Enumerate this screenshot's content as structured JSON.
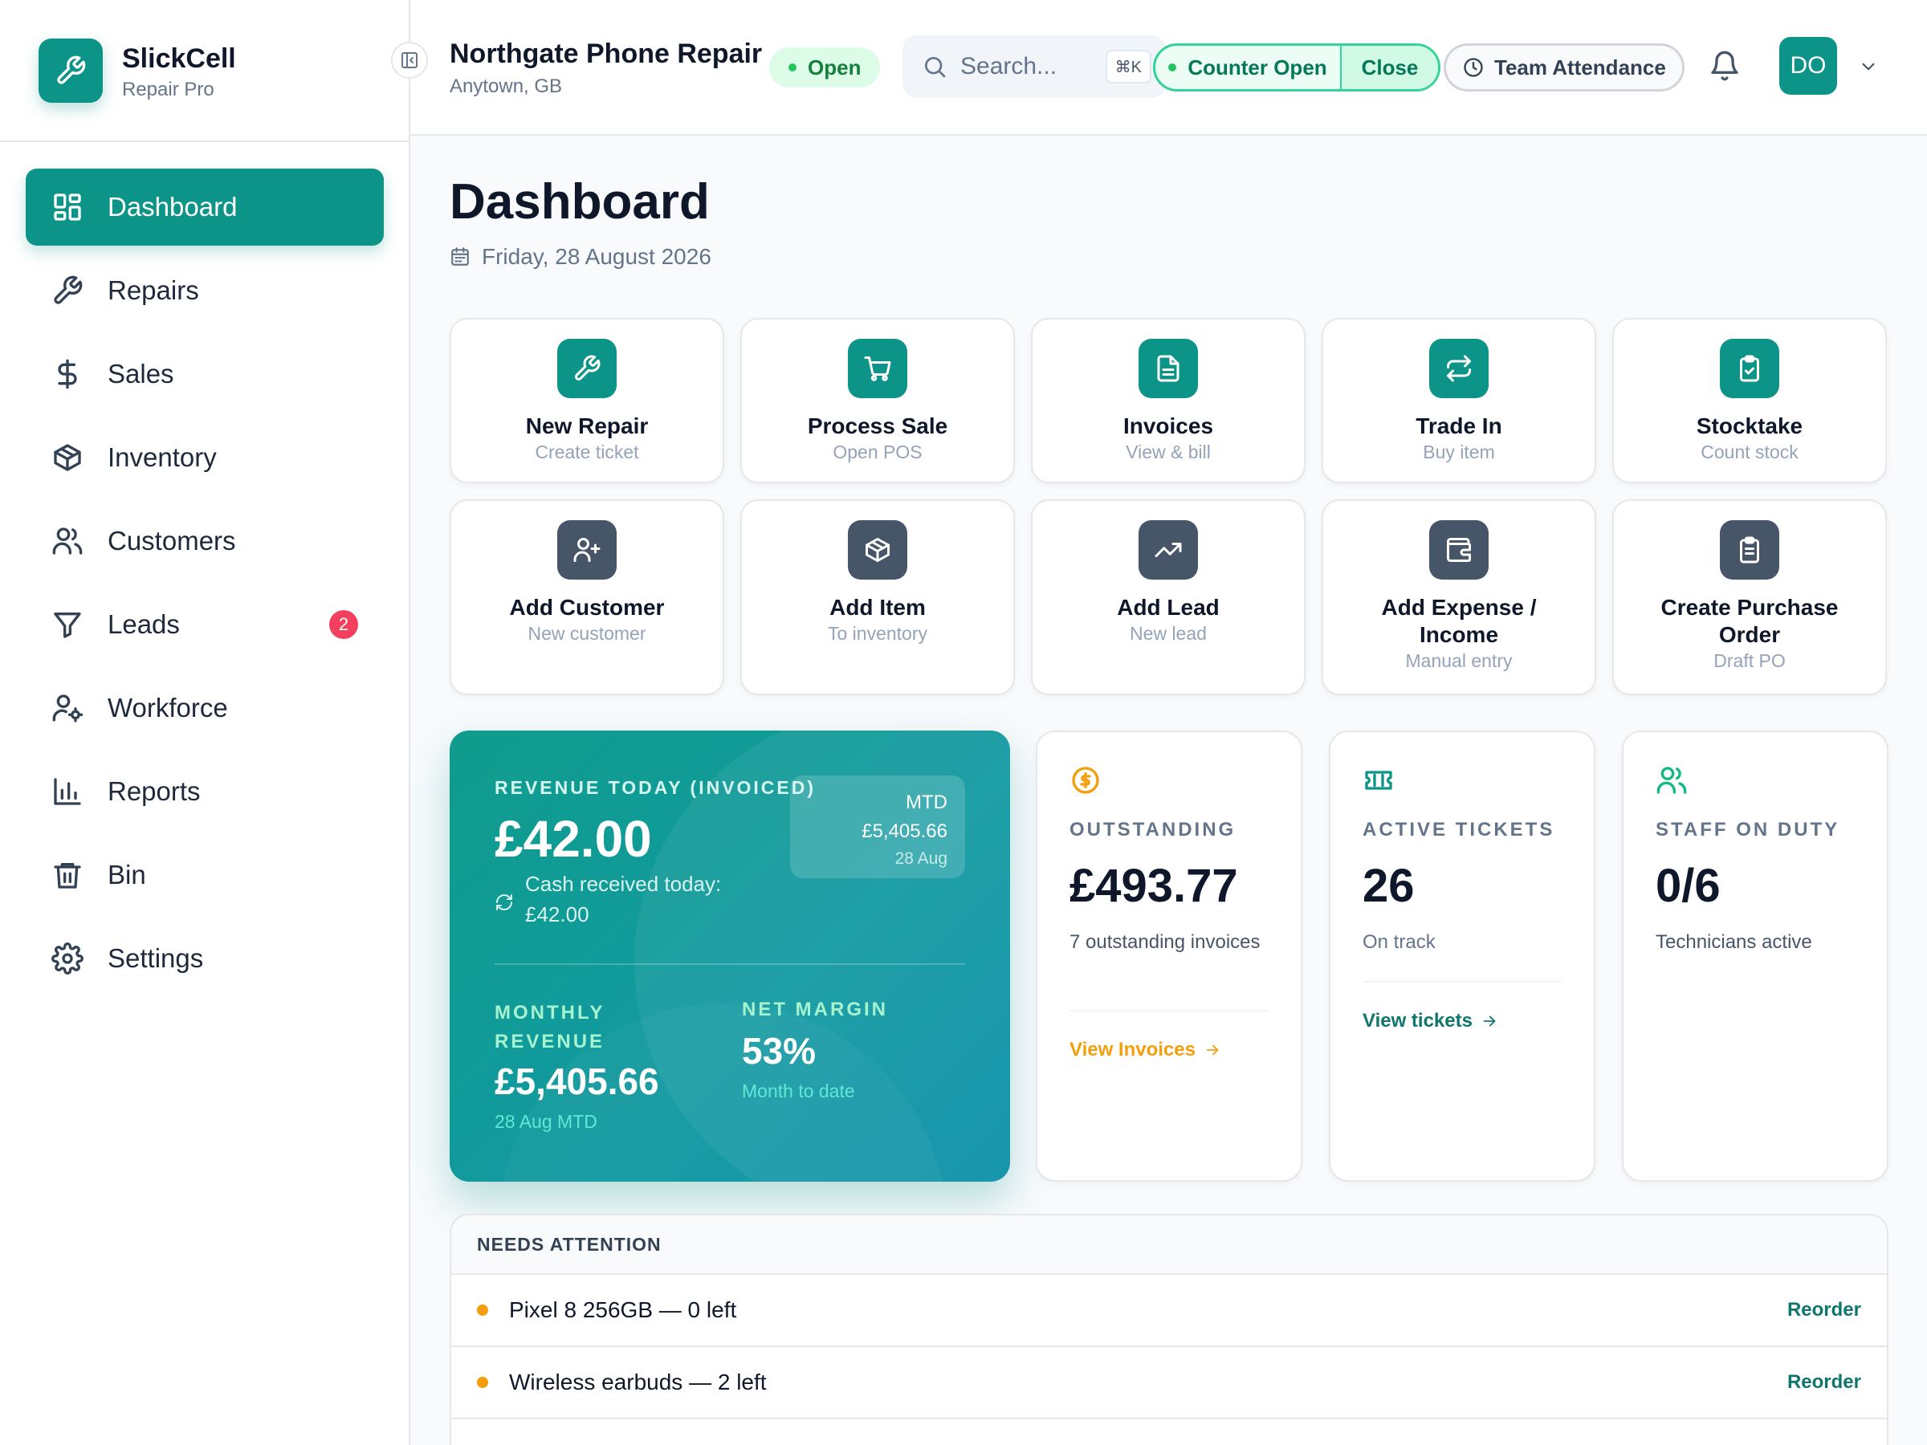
{
  "brand": {
    "name": "SlickCell",
    "subtitle": "Repair Pro",
    "logo_icon": "wrench-icon"
  },
  "sidebar": {
    "items": [
      {
        "label": "Dashboard",
        "icon": "dashboard-icon",
        "active": true
      },
      {
        "label": "Repairs",
        "icon": "wrench-icon"
      },
      {
        "label": "Sales",
        "icon": "dollar-icon"
      },
      {
        "label": "Inventory",
        "icon": "box-icon"
      },
      {
        "label": "Customers",
        "icon": "users-icon"
      },
      {
        "label": "Leads",
        "icon": "funnel-icon",
        "badge": "2"
      },
      {
        "label": "Workforce",
        "icon": "user-gear-icon"
      },
      {
        "label": "Reports",
        "icon": "bar-chart-icon"
      },
      {
        "label": "Bin",
        "icon": "trash-icon"
      },
      {
        "label": "Settings",
        "icon": "gear-icon"
      }
    ]
  },
  "header": {
    "shop_name": "Northgate Phone Repair",
    "location": "Anytown, GB",
    "status": "Open",
    "search_placeholder": "Search...",
    "search_shortcut": "⌘K",
    "counter_status": "Counter Open",
    "counter_close": "Close",
    "attendance": "Team Attendance",
    "avatar_initials": "DO"
  },
  "page": {
    "title": "Dashboard",
    "date": "Friday, 28 August 2026"
  },
  "actions": [
    {
      "title": "New Repair",
      "sub": "Create ticket",
      "icon": "wrench-icon",
      "color": "#0d9488"
    },
    {
      "title": "Process Sale",
      "sub": "Open POS",
      "icon": "cart-icon",
      "color": "#0d9488"
    },
    {
      "title": "Invoices",
      "sub": "View & bill",
      "icon": "document-icon",
      "color": "#0d9488"
    },
    {
      "title": "Trade In",
      "sub": "Buy item",
      "icon": "swap-icon",
      "color": "#0d9488"
    },
    {
      "title": "Stocktake",
      "sub": "Count stock",
      "icon": "clipboard-check-icon",
      "color": "#0d9488"
    },
    {
      "title": "Add Customer",
      "sub": "New customer",
      "icon": "user-plus-icon",
      "color": "#475569"
    },
    {
      "title": "Add Item",
      "sub": "To inventory",
      "icon": "box-icon",
      "color": "#475569"
    },
    {
      "title": "Add Lead",
      "sub": "New lead",
      "icon": "trending-up-icon",
      "color": "#475569"
    },
    {
      "title": "Add Expense / Income",
      "sub": "Manual entry",
      "icon": "wallet-icon",
      "color": "#475569"
    },
    {
      "title": "Create Purchase Order",
      "sub": "Draft PO",
      "icon": "clipboard-list-icon",
      "color": "#475569"
    }
  ],
  "revenue": {
    "label": "REVENUE TODAY (INVOICED)",
    "value": "£42.00",
    "cash_text": "Cash received today: £42.00",
    "mtd_label": "MTD",
    "mtd_value": "£5,405.66",
    "mtd_date": "28 Aug",
    "monthly_label": "MONTHLY REVENUE",
    "monthly_value": "£5,405.66",
    "monthly_sub": "28 Aug MTD",
    "margin_label": "NET MARGIN",
    "margin_value": "53%",
    "margin_sub": "Month to date"
  },
  "stats": {
    "outstanding": {
      "label": "OUTSTANDING",
      "value": "£493.77",
      "sub": "7 outstanding invoices",
      "link": "View Invoices",
      "icon": "dollar-circle-icon",
      "color": "#f59e0b"
    },
    "tickets": {
      "label": "ACTIVE TICKETS",
      "value": "26",
      "sub": "On track",
      "link": "View tickets",
      "icon": "ticket-icon",
      "color": "#0d9488"
    },
    "staff": {
      "label": "STAFF ON DUTY",
      "value": "0/6",
      "sub": "Technicians active",
      "icon": "users-icon",
      "color": "#10b981"
    }
  },
  "attention": {
    "title": "NEEDS ATTENTION",
    "items": [
      {
        "text": "Pixel 8 256GB — 0 left",
        "action": "Reorder"
      },
      {
        "text": "Wireless earbuds — 2 left",
        "action": "Reorder"
      }
    ]
  }
}
